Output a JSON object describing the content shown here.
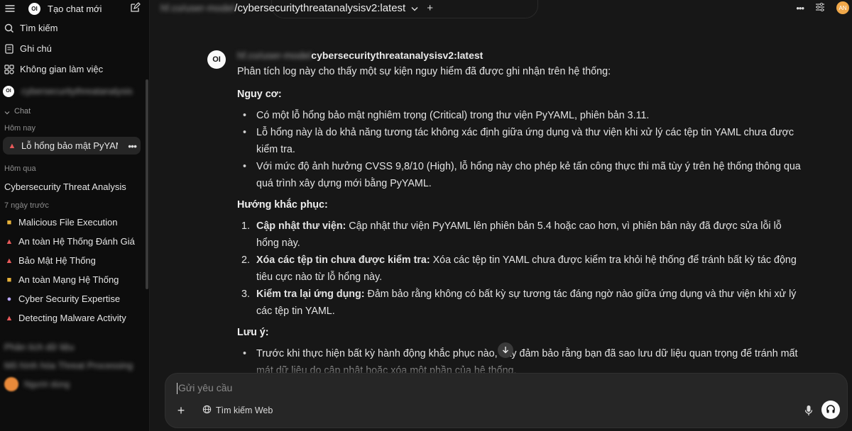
{
  "sidebar": {
    "new_chat_label": "Tạo chat mới",
    "search_label": "Tìm kiếm",
    "notes_label": "Ghi chú",
    "workspace_label": "Không gian làm việc",
    "model_blurred": "cybersecuritythreatanalysis",
    "chat_folder_label": "Chat",
    "today_label": "Hôm nay",
    "active_chat": "Lỗ hổng bảo mật PyYAML",
    "yesterday_label": "Hôm qua",
    "yesterday_chat": "Cybersecurity Threat Analysis",
    "week_label": "7 ngày trước",
    "week_chats": [
      {
        "label": "Malicious File Execution",
        "icon": "lock-emoji"
      },
      {
        "label": "An toàn Hệ Thống Đánh Giá",
        "icon": "alarm-emoji"
      },
      {
        "label": "Bảo Mật Hệ Thống",
        "icon": "alarm-emoji"
      },
      {
        "label": "An toàn Mạng Hệ Thống",
        "icon": "lock-emoji"
      },
      {
        "label": "Cyber Security Expertise",
        "icon": "robot-emoji"
      },
      {
        "label": "Detecting Malware Activity",
        "icon": "alarm-emoji"
      }
    ],
    "blurred_bottom": [
      "Phân tích dữ liệu",
      "Mô hình hóa Threat Processing",
      "Người dùng"
    ]
  },
  "header": {
    "model_name": "/cybersecuritythreatanalysisv2:latest",
    "model_prefix_blurred": "hf.co/user-model",
    "user_initials": "AN"
  },
  "message": {
    "model_title": "cybersecuritythreatanalysisv2:latest",
    "model_prefix_blurred": "hf.co/user-model",
    "intro": "Phân tích log này cho thấy một sự kiện nguy hiểm đã được ghi nhận trên hệ thống:",
    "risk_heading": "Nguy cơ:",
    "risks": [
      "Có một lỗ hổng bảo mật nghiêm trọng (Critical) trong thư viện PyYAML, phiên bản 3.11.",
      "Lỗ hổng này là do khả năng tương tác không xác định giữa ứng dụng và thư viện khi xử lý các tệp tin YAML chưa được kiểm tra.",
      "Với mức độ ảnh hưởng CVSS 9,8/10 (High), lỗ hổng này cho phép kẻ tấn công thực thi mã tùy ý trên hệ thống thông qua quá trình xây dựng mới bằng PyYAML."
    ],
    "fix_heading": "Hướng khắc phục:",
    "fixes": [
      {
        "num": "1.",
        "title": "Cập nhật thư viện:",
        "text": " Cập nhật thư viện PyYAML lên phiên bản 5.4 hoặc cao hơn, vì phiên bản này đã được sửa lỗi lỗ hổng này."
      },
      {
        "num": "2.",
        "title": "Xóa các tệp tin chưa được kiểm tra:",
        "text": " Xóa các tệp tin YAML chưa được kiểm tra khỏi hệ thống để tránh bất kỳ tác động tiêu cực nào từ lỗ hổng này."
      },
      {
        "num": "3.",
        "title": "Kiểm tra lại ứng dụng:",
        "text": " Đảm bảo rằng không có bất kỳ sự tương tác đáng ngờ nào giữa ứng dụng và thư viện khi xử lý các tệp tin YAML."
      }
    ],
    "note_heading": "Lưu ý:",
    "notes": [
      "Trước khi thực hiện bất kỳ hành động khắc phục nào, hãy đảm bảo rằng bạn đã sao lưu dữ liệu quan trọng để tránh mất mát dữ liệu do cập nhật hoặc xóa một phần của hệ thống."
    ]
  },
  "input": {
    "placeholder": "Gửi yêu cầu",
    "web_search_label": "Tìm kiếm Web"
  }
}
